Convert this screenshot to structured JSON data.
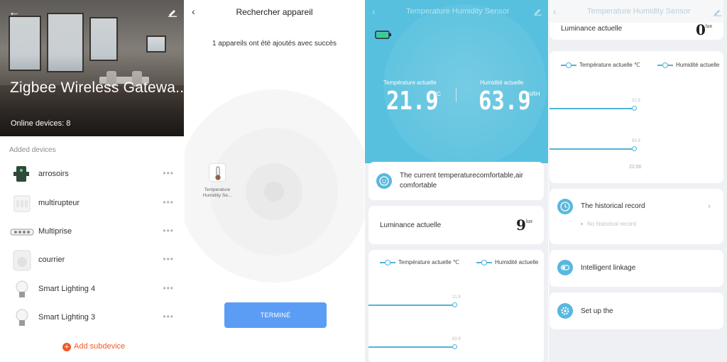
{
  "panel1": {
    "title": "Zigbee Wireless Gatewa..",
    "online_label": "Online devices: 8",
    "added_label": "Added devices",
    "devices": [
      {
        "name": "arrosoirs",
        "icon": "valve-icon"
      },
      {
        "name": "multirupteur",
        "icon": "switch-icon"
      },
      {
        "name": "Multiprise",
        "icon": "power-strip-icon"
      },
      {
        "name": "courrier",
        "icon": "motion-sensor-icon"
      },
      {
        "name": "Smart Lighting 4",
        "icon": "bulb-icon"
      },
      {
        "name": "Smart Lighting 3",
        "icon": "bulb-icon"
      }
    ],
    "more_glyph": "•••",
    "add_label": "Add subdevice",
    "accent": "#f05a28"
  },
  "panel2": {
    "title": "Rechercher appareil",
    "message": "1 appareils ont été ajoutés avec succès",
    "found_device": "Temperature Humidity Se...",
    "done_label": "TERMINÉ",
    "button_color": "#5b9df5"
  },
  "panel3": {
    "title": "Temperature Humidity Sensor",
    "temp_label": "Température actuelle",
    "temp_value": "21.9",
    "temp_unit": "°C",
    "hum_label": "Humidité actuelle",
    "hum_value": "63.9",
    "hum_unit": "%RH",
    "comfort_text": "The current temperaturecomfortable,air comfortable",
    "lux_label": "Luminance actuelle",
    "lux_value": "9",
    "lux_unit": "lux",
    "legend_temp": "Température actuelle ℃",
    "legend_hum": "Humidité actuelle",
    "chart_temp_value": "21.9",
    "chart_hum_value": "63.9",
    "accent": "#57c0de"
  },
  "panel4": {
    "title": "Temperature Humidity Sensor",
    "lux_label": "Luminance actuelle",
    "lux_value": "0",
    "lux_unit": "lux",
    "legend_temp": "Température actuelle ℃",
    "legend_hum": "Humidité actuelle",
    "chart_temp_value": "21.9",
    "chart_hum_value": "63.9",
    "chart_time": "22:00",
    "history_label": "The historical record",
    "history_empty": "No historical record",
    "linkage_label": "Intelligent linkage",
    "setup_label": "Set up the"
  }
}
